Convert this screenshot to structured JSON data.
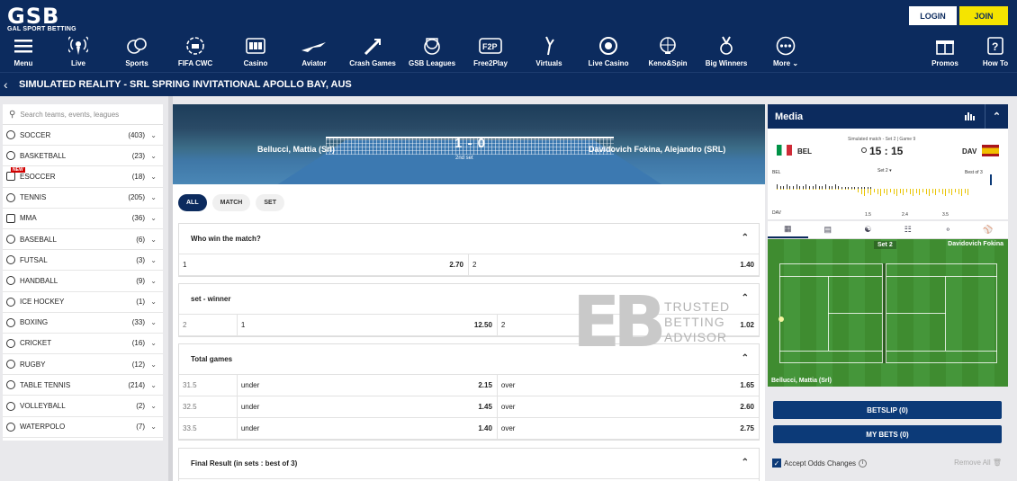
{
  "header": {
    "logo_big": "GSB",
    "logo_small": "GAL SPORT BETTING",
    "login_label": "LOGIN",
    "join_label": "JOIN",
    "nav": [
      {
        "label": "Menu",
        "icon": "menu-icon"
      },
      {
        "label": "Live",
        "icon": "live-icon"
      },
      {
        "label": "Sports",
        "icon": "sports-icon"
      },
      {
        "label": "FIFA CWC",
        "icon": "fifa-icon"
      },
      {
        "label": "Casino",
        "icon": "casino-icon"
      },
      {
        "label": "Aviator",
        "icon": "aviator-icon"
      },
      {
        "label": "Crash Games",
        "icon": "crash-games-icon"
      },
      {
        "label": "GSB Leagues",
        "icon": "gsb-leagues-icon"
      },
      {
        "label": "Free2Play",
        "icon": "free2play-icon"
      },
      {
        "label": "Virtuals",
        "icon": "virtuals-icon"
      },
      {
        "label": "Live Casino",
        "icon": "live-casino-icon"
      },
      {
        "label": "Keno&Spin",
        "icon": "keno-icon"
      },
      {
        "label": "Big Winners",
        "icon": "big-winners-icon"
      },
      {
        "label": "More",
        "icon": "more-icon"
      },
      {
        "label": "Promos",
        "icon": "promos-icon"
      },
      {
        "label": "How To",
        "icon": "how-to-icon"
      }
    ]
  },
  "breadcrumb": {
    "title": "SIMULATED REALITY - SRL SPRING INVITATIONAL APOLLO BAY, AUS"
  },
  "sidebar": {
    "search_placeholder": "Search teams, events, leagues",
    "new_badge": "NEW",
    "sports": [
      {
        "name": "SOCCER",
        "count": "(403)"
      },
      {
        "name": "BASKETBALL",
        "count": "(23)"
      },
      {
        "name": "ESOCCER",
        "count": "(18)"
      },
      {
        "name": "TENNIS",
        "count": "(205)"
      },
      {
        "name": "MMA",
        "count": "(36)"
      },
      {
        "name": "BASEBALL",
        "count": "(6)"
      },
      {
        "name": "FUTSAL",
        "count": "(3)"
      },
      {
        "name": "HANDBALL",
        "count": "(9)"
      },
      {
        "name": "ICE HOCKEY",
        "count": "(1)"
      },
      {
        "name": "BOXING",
        "count": "(33)"
      },
      {
        "name": "CRICKET",
        "count": "(16)"
      },
      {
        "name": "RUGBY",
        "count": "(12)"
      },
      {
        "name": "TABLE TENNIS",
        "count": "(214)"
      },
      {
        "name": "VOLLEYBALL",
        "count": "(2)"
      },
      {
        "name": "WATERPOLO",
        "count": "(7)"
      }
    ]
  },
  "match": {
    "player1": "Bellucci, Mattia (Srl)",
    "player2": "Davidovich Fokina, Alejandro (SRL)",
    "score": "1 - 0",
    "set_label": "2nd set"
  },
  "market_tabs": [
    "ALL",
    "MATCH",
    "SET"
  ],
  "markets": {
    "winner": {
      "title": "Who win the match?",
      "o1_label": "1",
      "o1": "2.70",
      "o2_label": "2",
      "o2": "1.40"
    },
    "set_winner": {
      "title": "set - winner",
      "set": "2",
      "o1_label": "1",
      "o1": "12.50",
      "o2_label": "2",
      "o2": "1.02"
    },
    "total_games": {
      "title": "Total games",
      "rows": [
        {
          "line": "31.5",
          "under_label": "under",
          "under": "2.15",
          "over_label": "over",
          "over": "1.65"
        },
        {
          "line": "32.5",
          "under_label": "under",
          "under": "1.45",
          "over_label": "over",
          "over": "2.60"
        },
        {
          "line": "33.5",
          "under_label": "under",
          "under": "1.40",
          "over_label": "over",
          "over": "2.75"
        }
      ]
    },
    "final_result": {
      "title": "Final Result (in sets : best of 3)"
    }
  },
  "watermark": {
    "logo": "EB",
    "line1": "TRUSTED",
    "line2": "BETTING",
    "line3": "ADVISOR"
  },
  "media": {
    "title": "Media",
    "info": "Simulated match - Set 2 | Game 9",
    "team1": "BEL",
    "team2": "DAV",
    "score": "15 : 15",
    "bel_label": "BEL",
    "dav_label": "DAV",
    "set_select": "Set 2",
    "best_of": "Best of 3",
    "ticks": [
      "1.5",
      "2.4",
      "3.5"
    ],
    "viz_set": "Set 2",
    "viz_player_top": "Davidovich Fokina",
    "viz_player_bottom": "Bellucci, Mattia (Srl)",
    "betslip_label": "BETSLIP (0)",
    "mybets_label": "MY BETS (0)",
    "accept_label": "Accept Odds Changes",
    "remove_label": "Remove All"
  },
  "colors": {
    "brand": "#0c2b5e",
    "join": "#f5e400"
  }
}
